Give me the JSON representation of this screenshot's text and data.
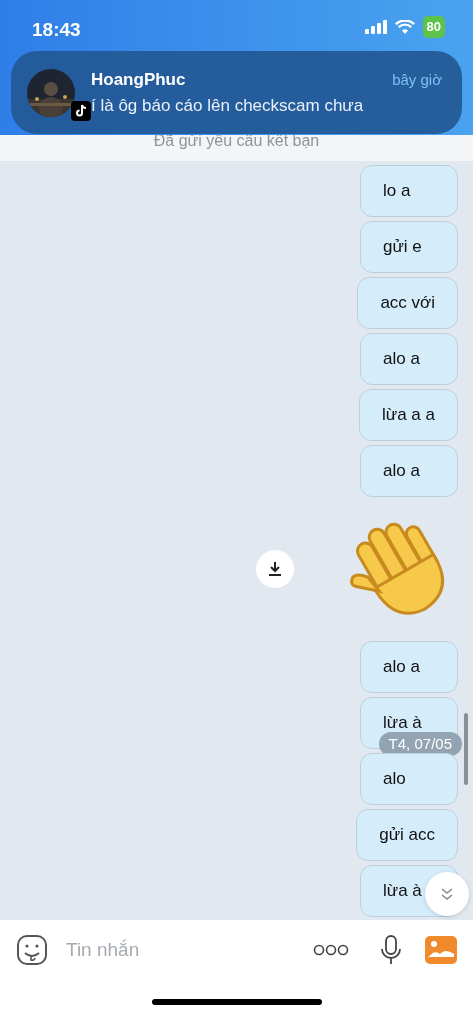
{
  "status_bar": {
    "time": "18:43",
    "battery": "80"
  },
  "notification": {
    "sender": "HoangPhuc",
    "time": "bây giờ",
    "message": "í là ôg báo cáo lên checkscam chưa"
  },
  "system_note": "Đã gửi yêu cầu kết bạn",
  "messages": [
    {
      "kind": "text",
      "text": "lo a"
    },
    {
      "kind": "text",
      "text": "gửi e"
    },
    {
      "kind": "text",
      "text": "acc với"
    },
    {
      "kind": "text",
      "text": "alo a"
    },
    {
      "kind": "text",
      "text": "lừa a a"
    },
    {
      "kind": "text",
      "text": "alo a"
    },
    {
      "kind": "sticker"
    },
    {
      "kind": "text",
      "text": "alo a"
    },
    {
      "kind": "text",
      "text": "lừa à",
      "timestamp": "T4, 07/05"
    },
    {
      "kind": "text",
      "text": "alo"
    },
    {
      "kind": "text",
      "text": "gửi acc"
    },
    {
      "kind": "text",
      "text": "lừa à"
    }
  ],
  "composer": {
    "placeholder": "Tin nhắn"
  }
}
